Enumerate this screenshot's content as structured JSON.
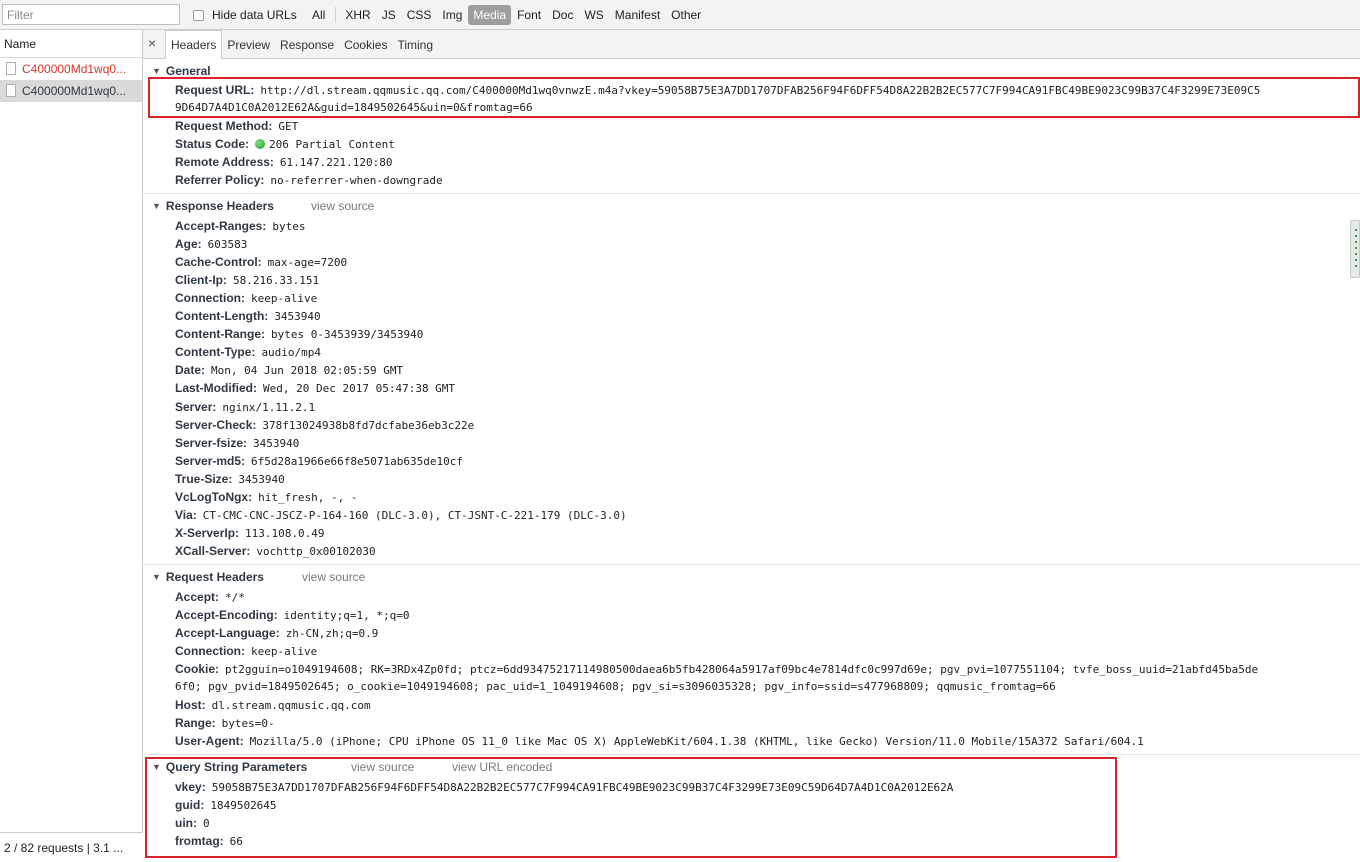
{
  "filterbar": {
    "filter_placeholder": "Filter",
    "hide_data_urls_label": "Hide data URLs",
    "all_label": "All",
    "types": [
      "XHR",
      "JS",
      "CSS",
      "Img",
      "Media",
      "Font",
      "Doc",
      "WS",
      "Manifest",
      "Other"
    ],
    "active_type": "Media"
  },
  "left": {
    "name_header": "Name",
    "requests": [
      {
        "name": "C400000Md1wq0...",
        "state": "error"
      },
      {
        "name": "C400000Md1wq0...",
        "state": "selected"
      }
    ],
    "status": "2 / 82 requests | 3.1 ..."
  },
  "tabs": {
    "close_glyph": "×",
    "items": [
      "Headers",
      "Preview",
      "Response",
      "Cookies",
      "Timing"
    ],
    "active": "Headers"
  },
  "general": {
    "title": "General",
    "request_url_key": "Request URL:",
    "request_url_line1": "http://dl.stream.qqmusic.qq.com/C400000Md1wq0vnwzE.m4a?vkey=59058B75E3A7DD1707DFAB256F94F6DFF54D8A22B2B2EC577C7F994CA91FBC49BE9023C99B37C4F3299E73E09C5",
    "request_url_line2": "9D64D7A4D1C0A2012E62A&guid=1849502645&uin=0&fromtag=66",
    "rows": [
      {
        "k": "Request Method:",
        "v": "GET"
      },
      {
        "k": "Status Code:",
        "v": "206 Partial Content"
      },
      {
        "k": "Remote Address:",
        "v": "61.147.221.120:80"
      },
      {
        "k": "Referrer Policy:",
        "v": "no-referrer-when-downgrade"
      }
    ]
  },
  "response_headers": {
    "title": "Response Headers",
    "view_source": "view source",
    "rows": [
      {
        "k": "Accept-Ranges:",
        "v": "bytes"
      },
      {
        "k": "Age:",
        "v": "603583"
      },
      {
        "k": "Cache-Control:",
        "v": "max-age=7200"
      },
      {
        "k": "Client-Ip:",
        "v": "58.216.33.151"
      },
      {
        "k": "Connection:",
        "v": "keep-alive"
      },
      {
        "k": "Content-Length:",
        "v": "3453940"
      },
      {
        "k": "Content-Range:",
        "v": "bytes 0-3453939/3453940"
      },
      {
        "k": "Content-Type:",
        "v": "audio/mp4"
      },
      {
        "k": "Date:",
        "v": "Mon, 04 Jun 2018 02:05:59 GMT"
      },
      {
        "k": "Last-Modified:",
        "v": "Wed, 20 Dec 2017 05:47:38 GMT"
      },
      {
        "k": "Server:",
        "v": "nginx/1.11.2.1"
      },
      {
        "k": "Server-Check:",
        "v": "378f13024938b8fd7dcfabe36eb3c22e"
      },
      {
        "k": "Server-fsize:",
        "v": "3453940"
      },
      {
        "k": "Server-md5:",
        "v": "6f5d28a1966e66f8e5071ab635de10cf"
      },
      {
        "k": "True-Size:",
        "v": "3453940"
      },
      {
        "k": "VcLogToNgx:",
        "v": "hit_fresh, -, -"
      },
      {
        "k": "Via:",
        "v": "CT-CMC-CNC-JSCZ-P-164-160 (DLC-3.0), CT-JSNT-C-221-179 (DLC-3.0)"
      },
      {
        "k": "X-ServerIp:",
        "v": "113.108.0.49"
      },
      {
        "k": "XCall-Server:",
        "v": "vochttp_0x00102030"
      }
    ]
  },
  "request_headers": {
    "title": "Request Headers",
    "view_source": "view source",
    "rows": [
      {
        "k": "Accept:",
        "v": "*/*"
      },
      {
        "k": "Accept-Encoding:",
        "v": "identity;q=1, *;q=0"
      },
      {
        "k": "Accept-Language:",
        "v": "zh-CN,zh;q=0.9"
      },
      {
        "k": "Connection:",
        "v": "keep-alive"
      },
      {
        "k": "Cookie:",
        "v": "pt2gguin=o1049194608; RK=3RDx4Zp0fd; ptcz=6dd93475217114980500daea6b5fb428064a5917af09bc4e7814dfc0c997d69e; pgv_pvi=1077551104; tvfe_boss_uuid=21abfd45ba5de"
      },
      {
        "k": "",
        "v": "6f0; pgv_pvid=1849502645; o_cookie=1049194608; pac_uid=1_1049194608; pgv_si=s3096035328; pgv_info=ssid=s477968809; qqmusic_fromtag=66"
      },
      {
        "k": "Host:",
        "v": "dl.stream.qqmusic.qq.com"
      },
      {
        "k": "Range:",
        "v": "bytes=0-"
      },
      {
        "k": "User-Agent:",
        "v": "Mozilla/5.0 (iPhone; CPU iPhone OS 11_0 like Mac OS X) AppleWebKit/604.1.38 (KHTML, like Gecko) Version/11.0 Mobile/15A372 Safari/604.1"
      }
    ]
  },
  "query_params": {
    "title": "Query String Parameters",
    "view_source": "view source",
    "view_url_encoded": "view URL encoded",
    "rows": [
      {
        "k": "vkey:",
        "v": "59058B75E3A7DD1707DFAB256F94F6DFF54D8A22B2B2EC577C7F994CA91FBC49BE9023C99B37C4F3299E73E09C59D64D7A4D1C0A2012E62A"
      },
      {
        "k": "guid:",
        "v": "1849502645"
      },
      {
        "k": "uin:",
        "v": "0"
      },
      {
        "k": "fromtag:",
        "v": "66"
      }
    ]
  },
  "colors": {
    "highlight": "#d8232a",
    "error_text": "#d9342b",
    "status_ok": "#1e9e1e",
    "active_filter_bg": "#9e9e9e"
  }
}
